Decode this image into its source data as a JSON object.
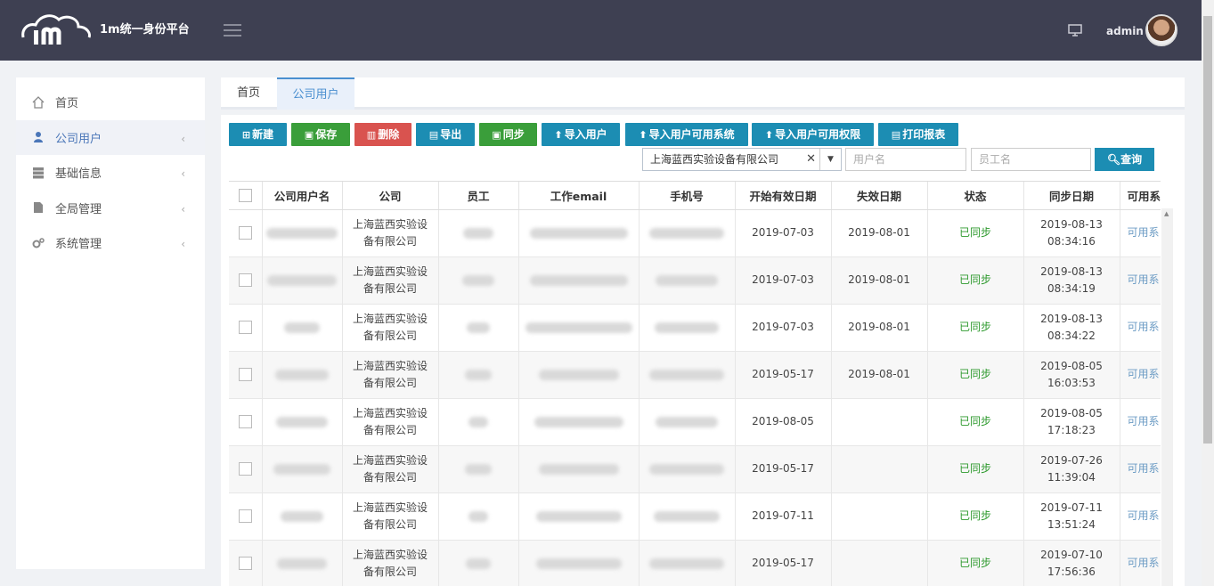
{
  "header": {
    "app_title": "1m统一身份平台",
    "username": "admin",
    "logo_text": "im"
  },
  "sidebar": {
    "items": [
      {
        "label": "首页",
        "icon": "home-icon"
      },
      {
        "label": "公司用户",
        "icon": "user-icon"
      },
      {
        "label": "基础信息",
        "icon": "server-icon"
      },
      {
        "label": "全局管理",
        "icon": "file-icon"
      },
      {
        "label": "系统管理",
        "icon": "cogs-icon"
      }
    ]
  },
  "tabs": [
    {
      "label": "首页"
    },
    {
      "label": "公司用户"
    }
  ],
  "toolbar": {
    "new": "新建",
    "save": "保存",
    "delete": "删除",
    "export": "导出",
    "sync": "同步",
    "import_users": "导入用户",
    "import_systems": "导入用户可用系统",
    "import_perms": "导入用户可用权限",
    "print": "打印报表"
  },
  "filters": {
    "company": "上海蓝西实验设备有限公司",
    "username_placeholder": "用户名",
    "employee_placeholder": "员工名",
    "search_label": "查询"
  },
  "table": {
    "headers": [
      "公司用户名",
      "公司",
      "员工",
      "工作email",
      "手机号",
      "开始有效日期",
      "失效日期",
      "状态",
      "同步日期",
      "可用系"
    ],
    "company_line1": "上海蓝西实验设",
    "company_line2": "备有限公司",
    "rows": [
      {
        "start": "2019-07-03",
        "end": "2019-08-01",
        "status": "已同步",
        "sync_date": "2019-08-13",
        "sync_time": "08:34:16",
        "avail": "可用系"
      },
      {
        "start": "2019-07-03",
        "end": "2019-08-01",
        "status": "已同步",
        "sync_date": "2019-08-13",
        "sync_time": "08:34:19",
        "avail": "可用系"
      },
      {
        "start": "2019-07-03",
        "end": "2019-08-01",
        "status": "已同步",
        "sync_date": "2019-08-13",
        "sync_time": "08:34:22",
        "avail": "可用系"
      },
      {
        "start": "2019-05-17",
        "end": "2019-08-01",
        "status": "已同步",
        "sync_date": "2019-08-05",
        "sync_time": "16:03:53",
        "avail": "可用系"
      },
      {
        "start": "2019-08-05",
        "end": "",
        "status": "已同步",
        "sync_date": "2019-08-05",
        "sync_time": "17:18:23",
        "avail": "可用系"
      },
      {
        "start": "2019-05-17",
        "end": "",
        "status": "已同步",
        "sync_date": "2019-07-26",
        "sync_time": "11:39:04",
        "avail": "可用系"
      },
      {
        "start": "2019-07-11",
        "end": "",
        "status": "已同步",
        "sync_date": "2019-07-11",
        "sync_time": "13:51:24",
        "avail": "可用系"
      },
      {
        "start": "2019-05-17",
        "end": "",
        "status": "已同步",
        "sync_date": "2019-07-10",
        "sync_time": "17:56:36",
        "avail": "可用系"
      }
    ]
  }
}
